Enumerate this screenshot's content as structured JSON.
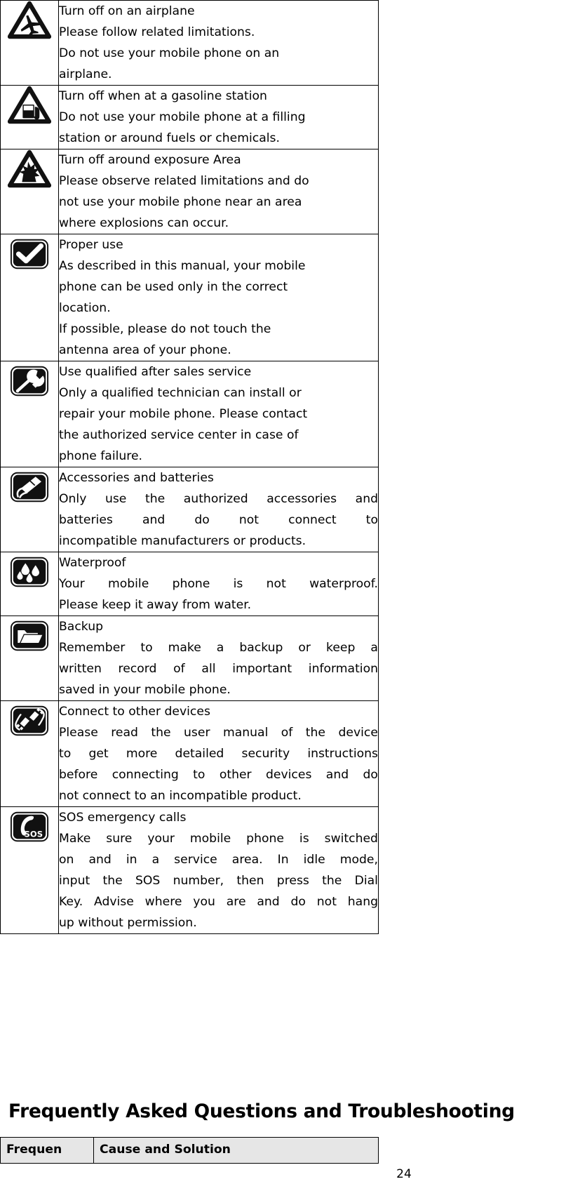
{
  "document": {
    "page_number": "24"
  },
  "safety_table": {
    "rows": [
      {
        "icon": "airplane-warning-icon",
        "justified": false,
        "lines": [
          "Turn off on an airplane",
          "Please follow related limitations.",
          "Do not use your mobile phone on an",
          "airplane."
        ]
      },
      {
        "icon": "gas-station-warning-icon",
        "justified": false,
        "lines": [
          "Turn off when at a gasoline station",
          "Do not use your mobile phone at a filling",
          "station or around fuels or chemicals."
        ]
      },
      {
        "icon": "explosion-warning-icon",
        "justified": false,
        "lines": [
          "Turn off around exposure Area",
          "Please observe related limitations and do",
          "not use your mobile phone near an area",
          "where explosions can occur."
        ]
      },
      {
        "icon": "checkmark-icon",
        "justified": false,
        "lines": [
          "Proper use",
          "As described in this manual, your mobile",
          "phone can be used only in the correct",
          "location.",
          "If possible, please do not touch the",
          "antenna area of your phone."
        ]
      },
      {
        "icon": "wrench-icon",
        "justified": false,
        "lines": [
          "Use qualified after sales service",
          "Only a qualified technician can install or",
          "repair your mobile phone. Please contact",
          "the authorized service center in case of",
          "phone failure."
        ]
      },
      {
        "icon": "battery-accessory-icon",
        "justified": true,
        "lines": [
          "Accessories and batteries",
          "Only use the authorized accessories and",
          "batteries and do not connect to",
          "incompatible manufacturers or products."
        ]
      },
      {
        "icon": "waterdrops-icon",
        "justified": true,
        "lines": [
          "Waterproof",
          "Your mobile phone is not waterproof.",
          "Please keep it away from water."
        ]
      },
      {
        "icon": "folder-backup-icon",
        "justified": true,
        "lines": [
          "Backup",
          "Remember to make a backup or keep a",
          "written record of all important information",
          "saved in your mobile phone."
        ]
      },
      {
        "icon": "plug-connect-icon",
        "justified": true,
        "lines": [
          "Connect to other devices",
          "Please read the user manual of the device",
          "to get more detailed security instructions",
          "before connecting to other devices and do",
          "not connect to an incompatible product."
        ]
      },
      {
        "icon": "sos-phone-icon",
        "justified": true,
        "lines": [
          "SOS emergency calls",
          "Make sure your mobile phone is switched",
          "on and in a service area. In idle mode,",
          "input the SOS number, then press the Dial",
          "Key. Advise where you are and do not hang",
          "up without permission."
        ]
      }
    ]
  },
  "faq_section": {
    "heading": "Frequently Asked Questions and Troubleshooting",
    "table": {
      "headers": [
        "Frequen",
        "Cause and Solution"
      ]
    }
  },
  "colors": {
    "border": "#000000",
    "header_fill": "#e6e6e6",
    "text": "#000000",
    "background": "#ffffff"
  }
}
